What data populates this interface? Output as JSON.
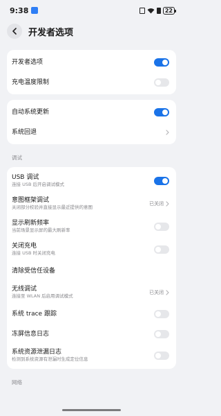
{
  "status_bar": {
    "time": "9:38",
    "battery": "22"
  },
  "header": {
    "title": "开发者选项"
  },
  "card1": [
    {
      "title": "开发者选项",
      "toggle": "on"
    },
    {
      "title": "充电温度限制",
      "toggle": "off"
    }
  ],
  "card2": [
    {
      "title": "自动系统更新",
      "toggle": "on"
    },
    {
      "title": "系统回退"
    }
  ],
  "section_debug": "调试",
  "debug_items": [
    {
      "title": "USB 调试",
      "sub": "连接 USB 后开启调试模式",
      "toggle": "on"
    },
    {
      "title": "意图框架调试",
      "sub": "关闭部分校验并直接显示最近提供的意图",
      "value": "已关闭"
    },
    {
      "title": "显示刷新频率",
      "sub": "当前场景显示屏的最大刷新率",
      "toggle": "off"
    },
    {
      "title": "关闭充电",
      "sub": "连接 USB 时关闭充电",
      "toggle": "off"
    },
    {
      "title": "清除受信任设备"
    },
    {
      "title": "无线调试",
      "sub": "连接至 WLAN 后启用调试模式",
      "value": "已关闭"
    },
    {
      "title": "系统 trace 跟踪",
      "toggle": "off"
    },
    {
      "title": "冻屏信息日志",
      "toggle": "off"
    },
    {
      "title": "系统资源泄漏日志",
      "sub": "检测到系统资源有泄漏时生成定位信息",
      "toggle": "off"
    }
  ],
  "section_network": "网络",
  "colors": {
    "accent": "#1a73e8",
    "background": "#f1f2f5",
    "card": "#ffffff"
  },
  "icons": {
    "back": "chevron-left-icon",
    "chevron": "chevron-right-icon"
  }
}
